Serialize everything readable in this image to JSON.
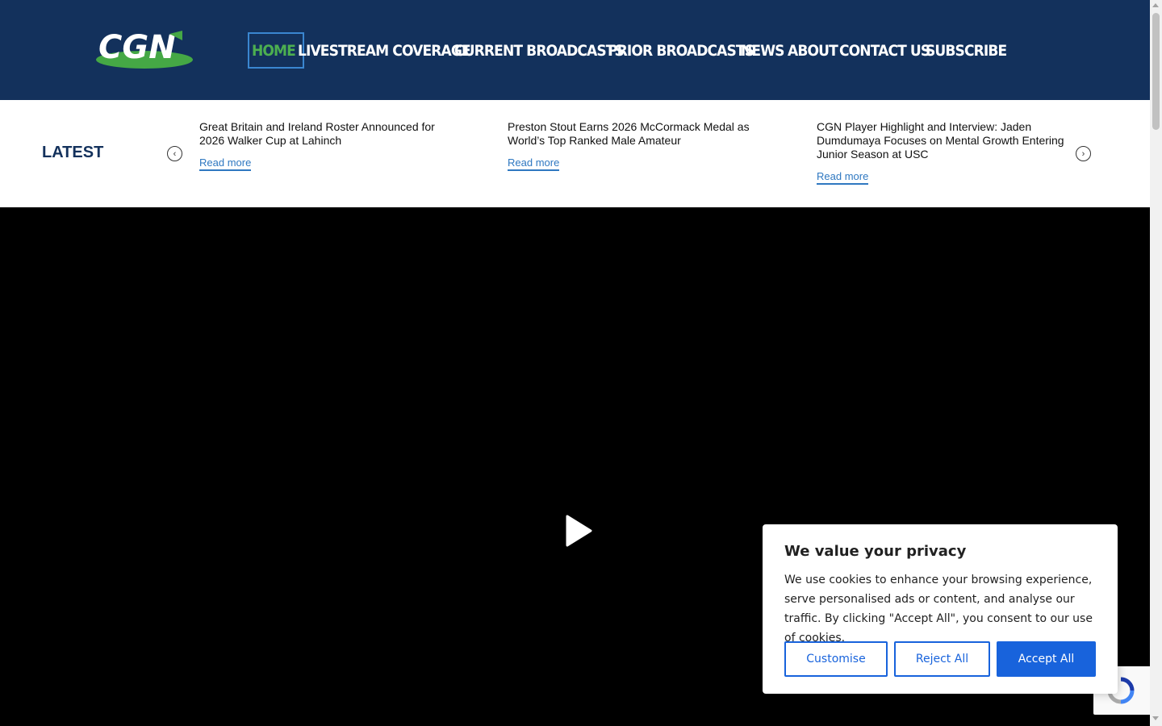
{
  "header": {
    "logo_text": "CGN",
    "nav": [
      {
        "label": "HOME",
        "active": true
      },
      {
        "label": "LIVESTREAM COVERAGE"
      },
      {
        "label": "CURRENT BROADCASTS"
      },
      {
        "label": "PRIOR BROADCASTS"
      },
      {
        "label": "NEWS"
      },
      {
        "label": "ABOUT"
      },
      {
        "label": "CONTACT US"
      },
      {
        "label": "SUBSCRIBE"
      }
    ]
  },
  "latest": {
    "label": "LATEST",
    "items": [
      {
        "title": "Great Britain and Ireland Roster Announced for 2026 Walker Cup at Lahinch",
        "link": "Read more"
      },
      {
        "title": "Preston Stout Earns 2026 McCormack Medal as World’s Top Ranked Male Amateur",
        "link": "Read more"
      },
      {
        "title": "CGN Player Highlight and Interview: Jaden Dumdumaya Focuses on Mental Growth Entering Junior Season at USC",
        "link": "Read more"
      }
    ]
  },
  "cookie": {
    "title": "We value your privacy",
    "text": "We use cookies to enhance your browsing experience, serve personalised ads or content, and analyse our traffic. By clicking \"Accept All\", you consent to our use of cookies.",
    "customise": "Customise",
    "reject": "Reject All",
    "accept": "Accept All"
  },
  "colors": {
    "header_bg": "#13315c",
    "accent_green": "#4caf50",
    "link_blue": "#2f78c1",
    "button_blue": "#1863dc"
  }
}
